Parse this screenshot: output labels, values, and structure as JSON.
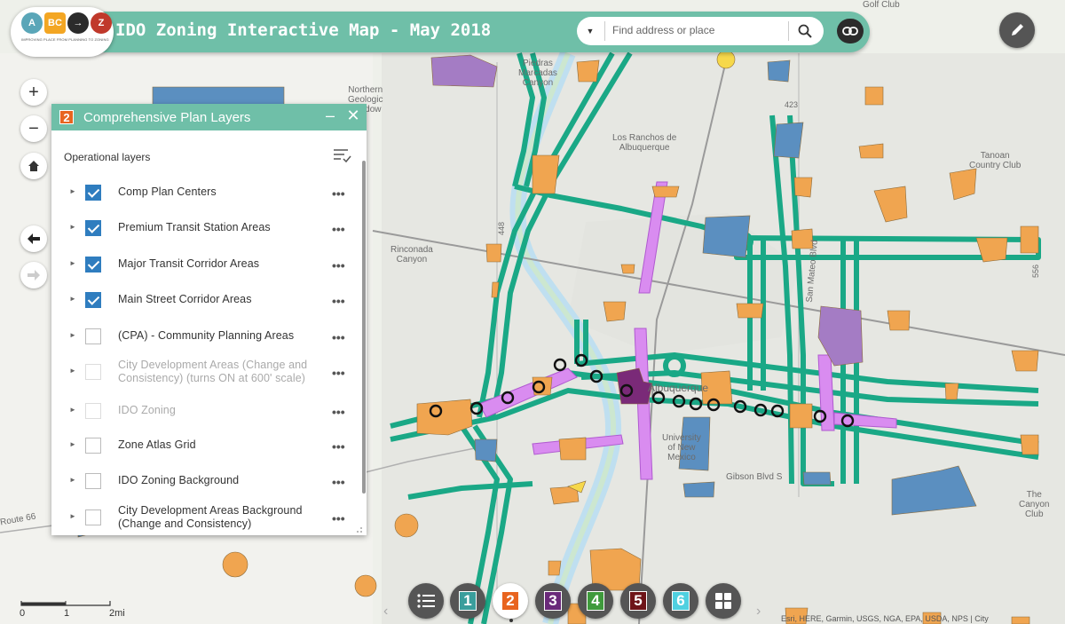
{
  "app": {
    "title": "IDO Zoning Interactive Map - May 2018",
    "logo_letters": [
      "A",
      "BC",
      "→",
      "Z"
    ],
    "logo_tagline": "IMPROVING PLACE FROM PLANNING TO ZONING"
  },
  "search": {
    "placeholder": "Find address or place",
    "value": ""
  },
  "panel": {
    "number": "2",
    "title": "Comprehensive Plan Layers",
    "section_label": "Operational layers",
    "layers": [
      {
        "label": "Comp Plan Centers",
        "checked": true,
        "enabled": true
      },
      {
        "label": "Premium Transit Station Areas",
        "checked": true,
        "enabled": true
      },
      {
        "label": "Major Transit Corridor Areas",
        "checked": true,
        "enabled": true
      },
      {
        "label": "Main Street Corridor Areas",
        "checked": true,
        "enabled": true
      },
      {
        "label": "(CPA) - Community Planning Areas",
        "checked": false,
        "enabled": true
      },
      {
        "label": "City Development Areas (Change and Consistency) (turns ON at 600' scale)",
        "checked": false,
        "enabled": false
      },
      {
        "label": "IDO Zoning",
        "checked": false,
        "enabled": false
      },
      {
        "label": "Zone Atlas Grid",
        "checked": false,
        "enabled": true
      },
      {
        "label": "IDO Zoning Background",
        "checked": false,
        "enabled": true
      },
      {
        "label": "City Development Areas Background (Change and Consistency)",
        "checked": false,
        "enabled": true
      }
    ],
    "more_glyph": "•••"
  },
  "widgets": [
    {
      "name": "layer-list",
      "label": "",
      "color": "#555555"
    },
    {
      "name": "widget-1",
      "label": "1",
      "color": "#3a9e9c"
    },
    {
      "name": "widget-2",
      "label": "2",
      "color": "#e8641f"
    },
    {
      "name": "widget-3",
      "label": "3",
      "color": "#6a2a7a"
    },
    {
      "name": "widget-4",
      "label": "4",
      "color": "#3f9a3c"
    },
    {
      "name": "widget-5",
      "label": "5",
      "color": "#6e1418"
    },
    {
      "name": "widget-6",
      "label": "6",
      "color": "#4fd0e0"
    },
    {
      "name": "grid-widget",
      "label": "",
      "color": "#555555"
    }
  ],
  "map_controls": {
    "zoom_in": "+",
    "zoom_out": "−"
  },
  "scale": {
    "ticks": [
      "0",
      "1",
      "2mi"
    ]
  },
  "map_labels": [
    {
      "text": "Golf Club"
    },
    {
      "text": "Piedras\nMarcadas\nCanyon"
    },
    {
      "text": "Northern\nGeologic\nWindow"
    },
    {
      "text": "Los Ranchos de\nAlbuquerque"
    },
    {
      "text": "Tanoan\nCountry Club"
    },
    {
      "text": "Rinconada\nCanyon"
    },
    {
      "text": "Albuquerque"
    },
    {
      "text": "University\nof New\nMexico"
    },
    {
      "text": "Gibson Blvd S"
    },
    {
      "text": "The\nCanyon\nClub"
    },
    {
      "text": "San Mateo Blvd"
    },
    {
      "text": "423"
    },
    {
      "text": "556"
    },
    {
      "text": "448"
    },
    {
      "text": "Route 66"
    }
  ],
  "attribution": "Esri, HERE, Garmin, USGS, NGA, EPA, USDA, NPS | City",
  "colors": {
    "header": "#6fbfa8",
    "transit_corridor": "#1aa886",
    "main_street": "#d98cf0",
    "center_orange": "#f0a550",
    "center_blue": "#5b8fc0",
    "center_purple": "#a47cc4",
    "downtown": "#7a2a78"
  }
}
